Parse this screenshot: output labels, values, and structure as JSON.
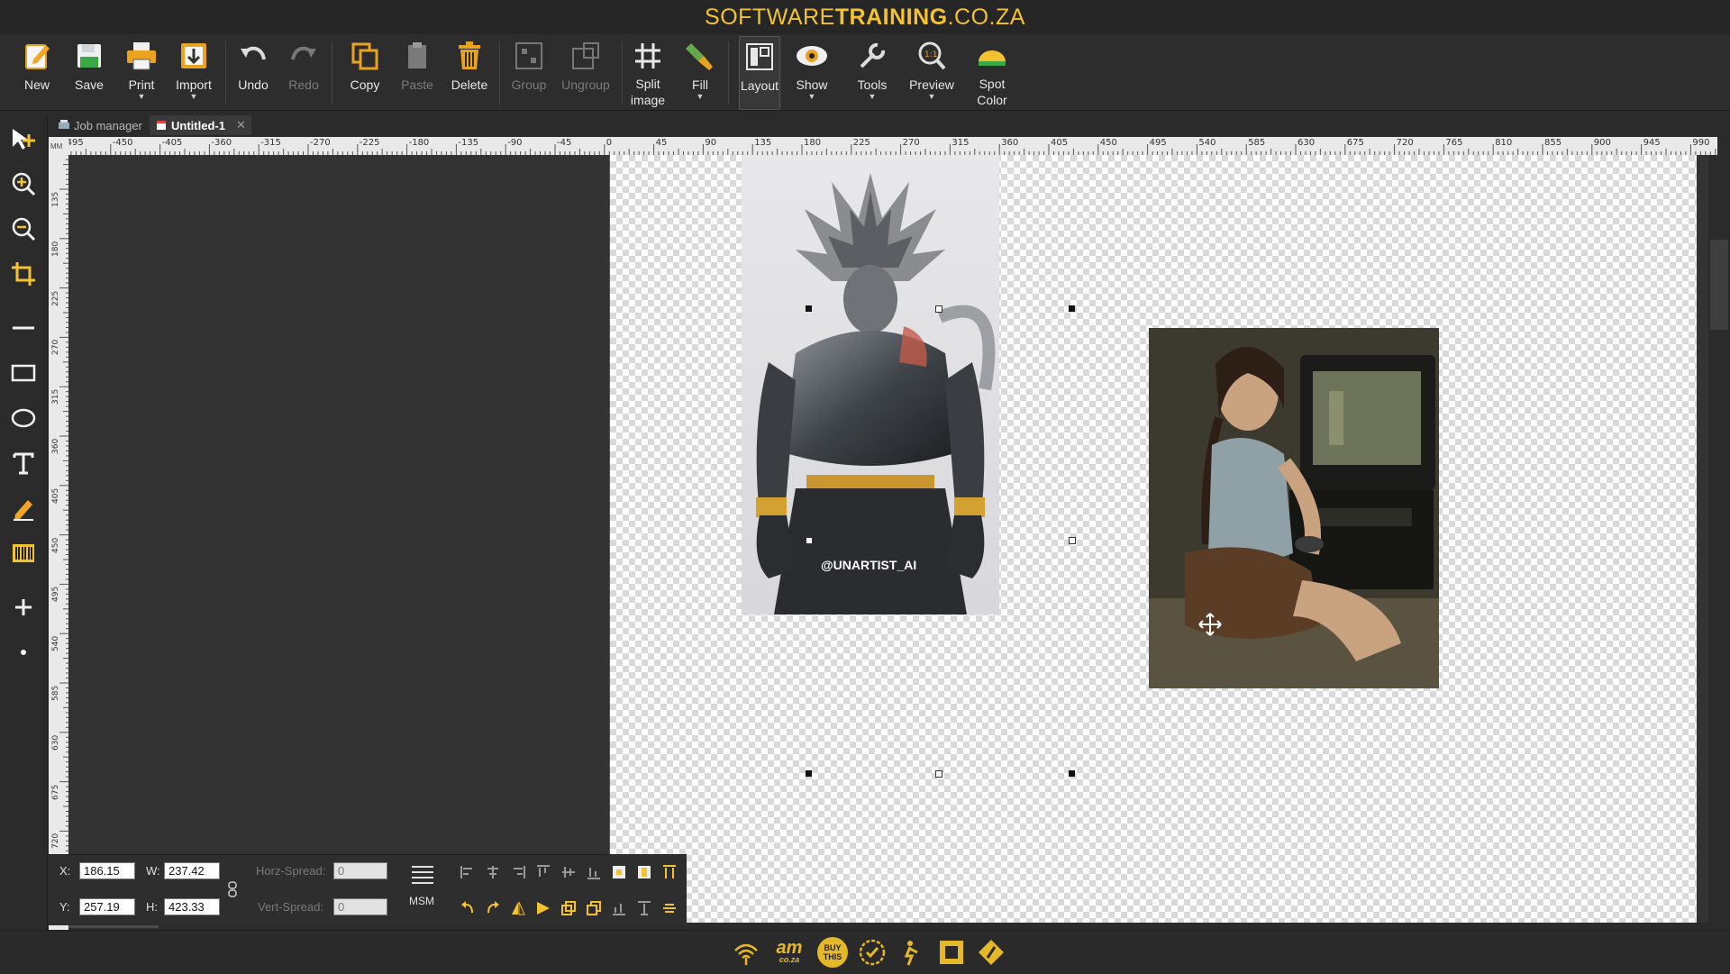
{
  "brand": {
    "part1": "SOFTWARE",
    "part2": "TRAINING",
    "part3": ".CO.ZA"
  },
  "toolbar": {
    "new": "New",
    "save": "Save",
    "print": "Print",
    "import": "Import",
    "undo": "Undo",
    "redo": "Redo",
    "copy": "Copy",
    "paste": "Paste",
    "delete": "Delete",
    "group": "Group",
    "ungroup": "Ungroup",
    "split_image": "Split\nimage",
    "fill": "Fill",
    "layout": "Layout",
    "show": "Show",
    "tools": "Tools",
    "preview": "Preview",
    "spot_color": "Spot\nColor"
  },
  "tabs": {
    "job_manager": "Job manager",
    "untitled": "Untitled-1"
  },
  "ruler": {
    "unit": "MM",
    "h_labels": [
      "-495",
      "-450",
      "-405",
      "-360",
      "-315",
      "-270",
      "-225",
      "-180",
      "-135",
      "-90",
      "-45",
      "0",
      "45",
      "90",
      "135",
      "180",
      "225",
      "270",
      "315",
      "360",
      "405",
      "450",
      "495",
      "540",
      "585",
      "630",
      "675",
      "720",
      "765",
      "810",
      "855",
      "900",
      "945",
      "990"
    ],
    "v_labels": [
      "135",
      "180",
      "225",
      "270",
      "315",
      "360",
      "405",
      "450",
      "495",
      "540",
      "585",
      "630",
      "675",
      "720"
    ]
  },
  "canvas": {
    "image1_watermark": "@UNARTIST_AI"
  },
  "properties": {
    "x_label": "X:",
    "x_value": "186.15",
    "y_label": "Y:",
    "y_value": "257.19",
    "w_label": "W:",
    "w_value": "237.42",
    "h_label": "H:",
    "h_value": "423.33",
    "horz_spread_label": "Horz-Spread:",
    "horz_spread_value": "0",
    "vert_spread_label": "Vert-Spread:",
    "vert_spread_value": "0",
    "msm_label": "MSM"
  },
  "status": {
    "logo_am": "am",
    "logo_am_sub": "co.za",
    "logo_buy": "BUY THIS"
  },
  "colors": {
    "accent": "#f2c230",
    "bg": "#2b2b2b"
  }
}
